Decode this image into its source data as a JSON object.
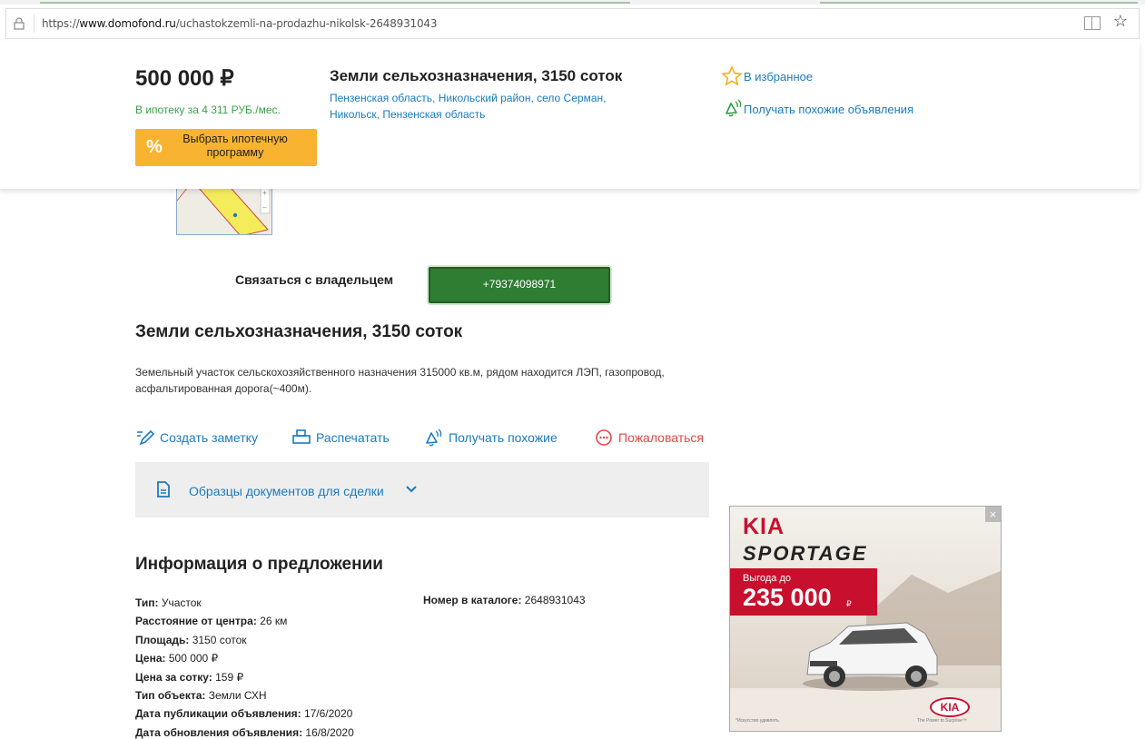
{
  "browser": {
    "url_prefix": "https://",
    "url_host": "www.domofond.ru",
    "url_path": "/uchastokzemli-na-prodazhu-nikolsk-2648931043"
  },
  "header": {
    "price": "500 000 ₽",
    "mortgage_text": "В ипотеку за 4 311 РУБ./мес.",
    "mortgage_button_icon": "%",
    "mortgage_button_label": "Выбрать ипотечную программу",
    "title": "Земли сельхозназначения, 3150 соток",
    "address": "Пензенская область, Никольский район, село Серман, Никольск, Пензенская область",
    "favorite_label": "В избранное",
    "similar_label": "Получать похожие объявления"
  },
  "contact": {
    "label": "Связаться с владельцем",
    "phone": "+79374098971"
  },
  "listing": {
    "title": "Земли сельхозназначения, 3150 соток",
    "description": "Земельный участок сельскохозяйственного назначения 315000 кв.м, рядом находится ЛЭП, газопровод, асфальтированная дорога(~400м)."
  },
  "actions": {
    "note": "Создать заметку",
    "print": "Распечатать",
    "similar": "Получать похожие",
    "report": "Пожаловаться"
  },
  "docs": {
    "label": "Образцы документов для сделки"
  },
  "info": {
    "title": "Информация о предложении",
    "rows": [
      {
        "k": "Тип:",
        "v": " Участок"
      },
      {
        "k": "Расстояние от центра:",
        "v": " 26 км"
      },
      {
        "k": "Площадь:",
        "v": " 3150 соток"
      },
      {
        "k": "Цена:",
        "v": " 500 000 ₽"
      },
      {
        "k": "Цена за сотку:",
        "v": " 159 ₽"
      },
      {
        "k": "Тип объекта:",
        "v": " Земли СХН"
      },
      {
        "k": "Дата публикации объявления:",
        "v": " 17/6/2020"
      },
      {
        "k": "Дата обновления объявления:",
        "v": " 16/8/2020"
      }
    ],
    "catalog_key": "Номер в каталоге:",
    "catalog_value": " 2648931043"
  },
  "ad": {
    "brand": "KIA",
    "model": "SPORTAGE",
    "promo_label": "Выгода до",
    "promo_value": "235 000",
    "promo_currency": "₽",
    "logo": "KIA",
    "fine_print": "*Искусство удивлять",
    "slogan": "The Power to Surprise™",
    "close": "×"
  },
  "colors": {
    "link": "#1a7bbf",
    "green": "#2e7d32",
    "mortgage_green": "#3ca04a",
    "orange": "#f8b331",
    "red": "#e24848"
  }
}
